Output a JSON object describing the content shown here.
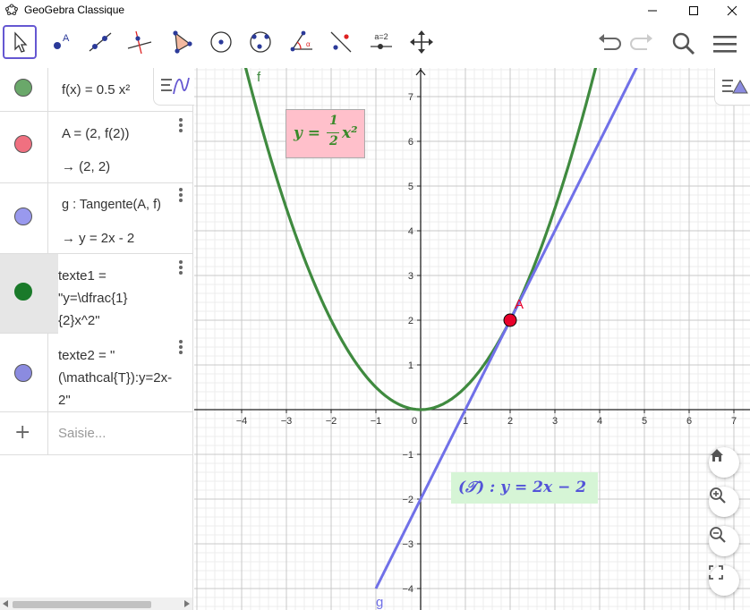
{
  "window": {
    "title": "GeoGebra Classique"
  },
  "toolbar": {
    "tools": [
      "move",
      "point",
      "line",
      "perpendicular",
      "polygon",
      "circle-center",
      "circle-3pts",
      "angle",
      "reflect",
      "slider",
      "move-graphics"
    ],
    "slider_label": "a=2"
  },
  "algebra": {
    "rows": [
      {
        "color": "#6aa86a",
        "line1": "f(x)  =  0.5 x²",
        "line2": ""
      },
      {
        "color": "#f07080",
        "line1": "A  =  (2, f(2))",
        "line2": "→   (2, 2)"
      },
      {
        "color": "#9999ee",
        "line1": "g : Tangente(A, f)",
        "line2": "→   y = 2x - 2"
      },
      {
        "color": "#1a7a2a",
        "line1": "texte1  =",
        "line2": "\"y=\\dfrac{1}",
        "line3": "{2}x^2\""
      },
      {
        "color": "#8b8be0",
        "line1": "texte2  =  \"",
        "line2": "(\\mathcal{T}):y=2x-",
        "line3": "2\""
      }
    ],
    "input_placeholder": "Saisie..."
  },
  "graph": {
    "x_ticks": [
      "−4",
      "−3",
      "−2",
      "−1",
      "0",
      "1",
      "2",
      "3",
      "4",
      "5",
      "6",
      "7"
    ],
    "y_ticks": [
      "−4",
      "−3",
      "−2",
      "−1",
      "1",
      "2",
      "3",
      "4",
      "5",
      "6",
      "7"
    ],
    "curve_label": "f",
    "line_label": "g",
    "point_label": "A",
    "point": {
      "x": 2,
      "y": 2
    },
    "text1": "y = ½x²",
    "text1_num": "1",
    "text1_den": "2",
    "text1_lhs": "y = ",
    "text1_rhs": "x²",
    "text2": "(𝒯) : y = 2x − 2",
    "colors": {
      "curve": "#3f8a3f",
      "line": "#7070e8",
      "point": "#e8002a",
      "text1_bg": "#ffc0cb",
      "text2_bg": "#d6f5d6"
    }
  }
}
